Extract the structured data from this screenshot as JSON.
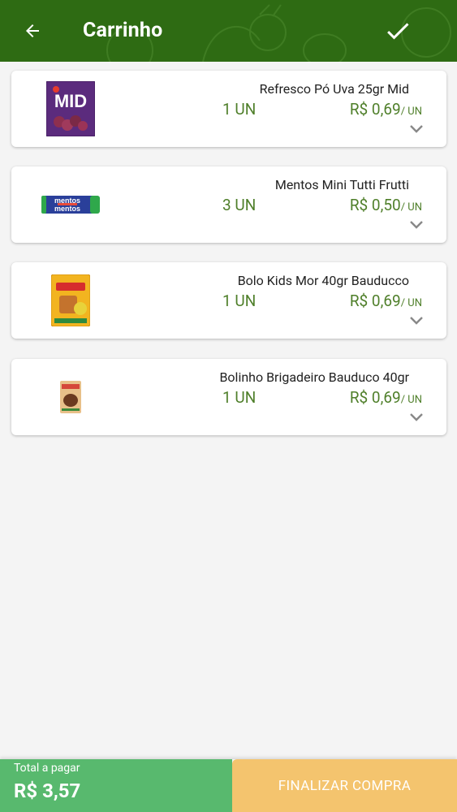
{
  "header": {
    "title": "Carrinho",
    "back_icon": "arrow-left-icon",
    "confirm_icon": "check-icon",
    "color": "#2e6b13"
  },
  "cart": {
    "items": [
      {
        "name": "Refresco Pó Uva 25gr Mid",
        "qty": "1 UN",
        "price": "R$ 0,69",
        "unit": "/ UN",
        "image": "mid-package"
      },
      {
        "name": "Mentos Mini Tutti Frutti",
        "qty": "3 UN",
        "price": "R$ 0,50",
        "unit": "/ UN",
        "image": "mentos-roll"
      },
      {
        "name": "Bolo Kids Mor 40gr Bauducco",
        "qty": "1 UN",
        "price": "R$ 0,69",
        "unit": "/ UN",
        "image": "bauducco-kids"
      },
      {
        "name": "Bolinho Brigadeiro Bauduco 40gr",
        "qty": "1 UN",
        "price": "R$ 0,69",
        "unit": "/ UN",
        "image": "bauducco-brigadeiro"
      }
    ]
  },
  "footer": {
    "total_label": "Total a pagar",
    "total_value": "R$ 3,57",
    "finish_label": "FINALIZAR COMPRA",
    "total_color": "#58b96e",
    "finish_color": "#f4c46e"
  }
}
